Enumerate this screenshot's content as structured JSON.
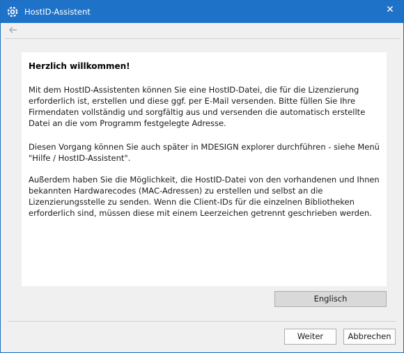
{
  "window": {
    "title": "HostID-Assistent",
    "close_glyph": "✕",
    "app_icon": "gear-icon",
    "titlebar_color": "#1e73c9"
  },
  "nav": {
    "back_icon": "back-arrow-icon"
  },
  "content": {
    "heading": "Herzlich willkommen!",
    "paragraph1": [
      "Mit dem HostID-Assistenten können Sie eine HostID-Datei, die für die Lizenzierung",
      "erforderlich ist, erstellen und diese ggf. per E-Mail versenden. Bitte füllen Sie Ihre",
      "Firmendaten vollständig und sorgfältig aus und versenden die automatisch erstellte",
      "Datei an die vom Programm festgelegte Adresse."
    ],
    "paragraph2": [
      "Diesen Vorgang können Sie auch später in MDESIGN explorer durchführen - siehe Menü",
      "\"Hilfe / HostID-Assistent\"."
    ],
    "paragraph3": [
      "Außerdem haben Sie die Möglichkeit, die HostID-Datei von den vorhandenen und Ihnen",
      "bekannten Hardwarecodes (MAC-Adressen) zu erstellen und selbst an die",
      "Lizenzierungsstelle zu senden. Wenn die Client-IDs für die einzelnen Bibliotheken",
      "erforderlich sind, müssen diese mit einem Leerzeichen getrennt geschrieben werden."
    ]
  },
  "buttons": {
    "language": "Englisch",
    "next": "Weiter",
    "cancel": "Abbrechen"
  }
}
